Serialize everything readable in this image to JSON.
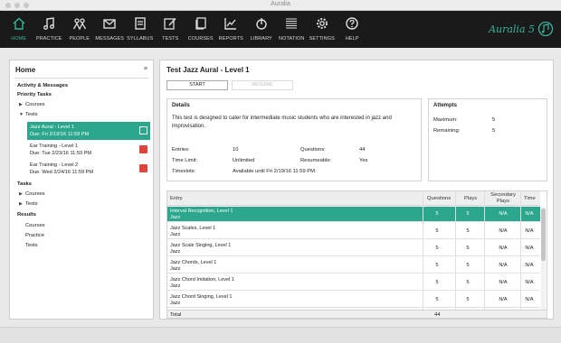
{
  "window": {
    "title": "Auralia"
  },
  "nav": [
    {
      "label": "HOME",
      "icon": "home-icon",
      "active": true
    },
    {
      "label": "PRACTICE",
      "icon": "music-note-icon"
    },
    {
      "label": "PEOPLE",
      "icon": "people-icon"
    },
    {
      "label": "MESSAGES",
      "icon": "envelope-icon"
    },
    {
      "label": "SYLLABUS",
      "icon": "document-icon"
    },
    {
      "label": "TESTS",
      "icon": "edit-icon"
    },
    {
      "label": "COURSES",
      "icon": "courses-icon"
    },
    {
      "label": "REPORTS",
      "icon": "chart-icon"
    },
    {
      "label": "LIBRARY",
      "icon": "library-icon"
    },
    {
      "label": "NOTATION",
      "icon": "staff-icon"
    },
    {
      "label": "SETTINGS",
      "icon": "gear-icon"
    },
    {
      "label": "HELP",
      "icon": "help-icon"
    }
  ],
  "brand": {
    "name": "Auralia 5",
    "accent": "#35b59a"
  },
  "sidebar": {
    "title": "Home",
    "menu_icon": "≡",
    "activity": "Activity & Messages",
    "priority_tasks": "Priority Tasks",
    "courses": "Courses",
    "tests": "Tests",
    "tasks_heading": "Tasks",
    "task_courses": "Courses",
    "task_tests": "Tests",
    "results_heading": "Results",
    "results": [
      "Courses",
      "Practice",
      "Tests"
    ],
    "priority_items": [
      {
        "name": "Jazz Aural - Level 1",
        "due": "Due: Fri 2/19/16 11:59 PM",
        "selected": true
      },
      {
        "name": "Ear Training - Level 1",
        "due": "Due: Tue 2/23/16 11:59 PM"
      },
      {
        "name": "Ear Training - Level 2",
        "due": "Due: Wed 2/24/16 11:59 PM"
      }
    ]
  },
  "main": {
    "title": "Test Jazz Aural - Level 1",
    "start_label": "START",
    "second_label": "RESUME",
    "details": {
      "title": "Details",
      "description": "This test is designed to cater for intermediate music students who are interested in jazz and improvisation.",
      "entries_label": "Entries:",
      "entries": "10",
      "questions_label": "Questions:",
      "questions": "44",
      "time_limit_label": "Time Limit:",
      "time_limit": "Unlimited",
      "resumeable_label": "Resumeable:",
      "resumeable": "Yes",
      "timeslots_label": "Timeslots:",
      "timeslots": "Available until Fri 2/19/16 11:59 PM."
    },
    "attempts": {
      "title": "Attempts",
      "maximum_label": "Maximum:",
      "maximum": "5",
      "remaining_label": "Remaining:",
      "remaining": "5"
    },
    "table": {
      "headers": [
        "Entry",
        "Questions",
        "Plays",
        "Secondary Plays",
        "Time"
      ],
      "rows": [
        {
          "entry": "Interval Recognition, Level 1",
          "sub": "Jazz",
          "questions": "5",
          "plays": "5",
          "secondary": "N/A",
          "time": "N/A",
          "selected": true
        },
        {
          "entry": "Jazz Scales, Level 1",
          "sub": "Jazz",
          "questions": "5",
          "plays": "5",
          "secondary": "N/A",
          "time": "N/A"
        },
        {
          "entry": "Jazz Scale Singing, Level 1",
          "sub": "Jazz",
          "questions": "5",
          "plays": "5",
          "secondary": "N/A",
          "time": "N/A"
        },
        {
          "entry": "Jazz Chords, Level 1",
          "sub": "Jazz",
          "questions": "5",
          "plays": "5",
          "secondary": "N/A",
          "time": "N/A"
        },
        {
          "entry": "Jazz Chord Imitation, Level 1",
          "sub": "Jazz",
          "questions": "5",
          "plays": "5",
          "secondary": "N/A",
          "time": "N/A"
        },
        {
          "entry": "Jazz Chord Singing, Level 1",
          "sub": "Jazz",
          "questions": "5",
          "plays": "5",
          "secondary": "N/A",
          "time": "N/A"
        }
      ],
      "total_label": "Total",
      "total_questions": "44"
    }
  }
}
